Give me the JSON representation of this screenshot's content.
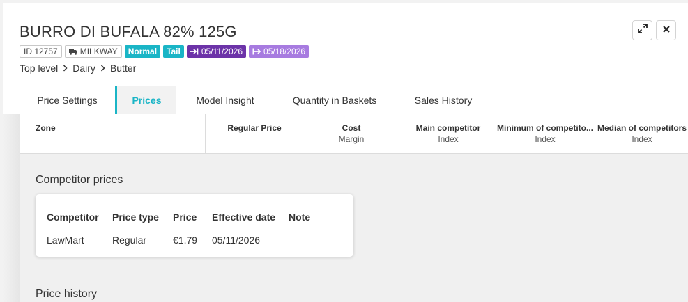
{
  "product": {
    "title": "BURRO DI BUFALA 82% 125G",
    "id_label": "ID 12757",
    "brand": "MILKWAY",
    "tag_normal": "Normal",
    "tag_tail": "Tail",
    "date_start": "05/11/2026",
    "date_end": "05/18/2026"
  },
  "breadcrumb": [
    "Top level",
    "Dairy",
    "Butter"
  ],
  "tabs": [
    "Price Settings",
    "Prices",
    "Model Insight",
    "Quantity in Baskets",
    "Sales History"
  ],
  "active_tab": "Prices",
  "table_header": {
    "zone": "Zone",
    "regular_price": "Regular Price",
    "cost": "Cost",
    "cost_sub": "Margin",
    "main_competitor": "Main competitor",
    "main_competitor_sub": "Index",
    "min_competitors": "Minimum of competito...",
    "min_competitors_sub": "Index",
    "median_competitors": "Median of competitors",
    "median_competitors_sub": "Index"
  },
  "competitor_prices": {
    "title": "Competitor prices",
    "columns": [
      "Competitor",
      "Price type",
      "Price",
      "Effective date",
      "Note"
    ],
    "rows": [
      {
        "competitor": "LawMart",
        "price_type": "Regular",
        "price": "€1.79",
        "effective_date": "05/11/2026",
        "note": ""
      }
    ]
  },
  "price_history": {
    "title": "Price history"
  },
  "colors": {
    "accent_cyan": "#1ab5c6",
    "purple_dark": "#6c33a8",
    "purple_light": "#a77be0"
  },
  "icons": {
    "expand": "expand-arrows-icon",
    "close": "close-icon",
    "truck": "truck-icon",
    "start_date": "arrow-to-line-icon",
    "end_date": "arrow-from-box-icon",
    "chevron": "chevron-right-icon"
  }
}
